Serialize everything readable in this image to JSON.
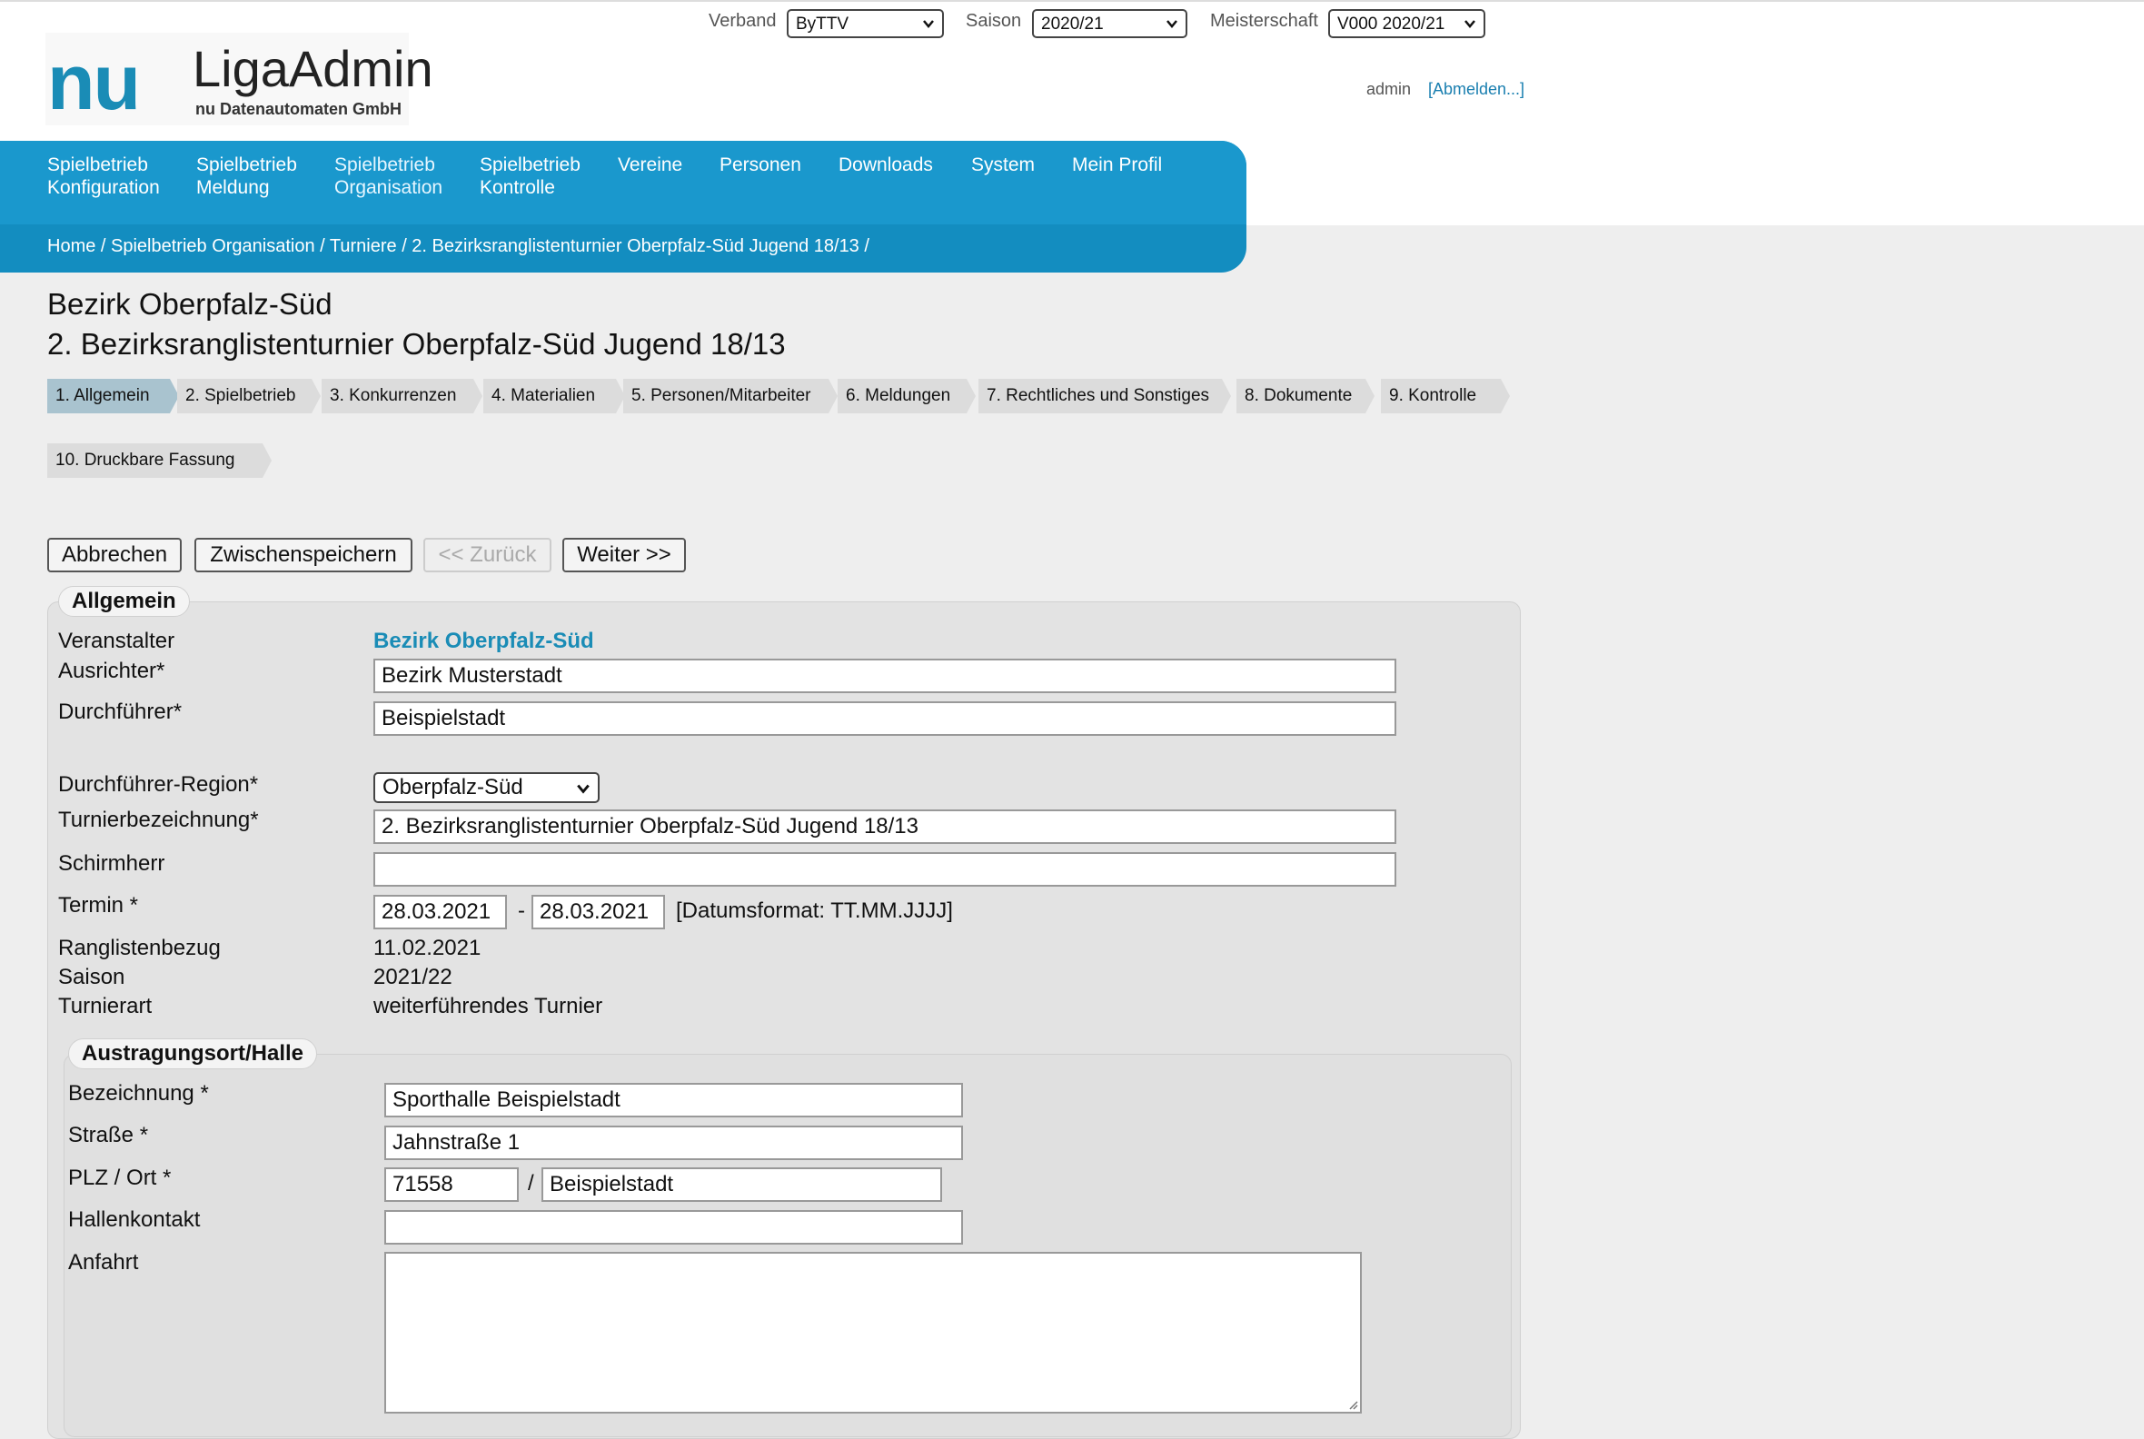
{
  "header": {
    "verband_label": "Verband",
    "verband_value": "ByTTV",
    "saison_label": "Saison",
    "saison_value": "2020/21",
    "meisterschaft_label": "Meisterschaft",
    "meisterschaft_value": "V000 2020/21",
    "user": "admin",
    "logout": "[Abmelden...]"
  },
  "logo": {
    "nu": "nu",
    "name": "LigaAdmin",
    "sub": "nu Datenautomaten GmbH"
  },
  "nav": {
    "items": [
      {
        "line1": "Spielbetrieb",
        "line2": "Konfiguration"
      },
      {
        "line1": "Spielbetrieb",
        "line2": "Meldung"
      },
      {
        "line1": "Spielbetrieb",
        "line2": "Organisation"
      },
      {
        "line1": "Spielbetrieb",
        "line2": "Kontrolle"
      },
      {
        "line1": "Vereine",
        "line2": ""
      },
      {
        "line1": "Personen",
        "line2": ""
      },
      {
        "line1": "Downloads",
        "line2": ""
      },
      {
        "line1": "System",
        "line2": ""
      },
      {
        "line1": "Mein Profil",
        "line2": ""
      }
    ],
    "breadcrumb": "Home / Spielbetrieb Organisation / Turniere / 2. Bezirksranglistenturnier Oberpfalz-Süd Jugend 18/13 /"
  },
  "page": {
    "title1": "Bezirk Oberpfalz-Süd",
    "title2": "2. Bezirksranglistenturnier Oberpfalz-Süd Jugend 18/13"
  },
  "tabs": [
    "1. Allgemein",
    "2. Spielbetrieb",
    "3. Konkurrenzen",
    "4. Materialien",
    "5. Personen/Mitarbeiter",
    "6. Meldungen",
    "7. Rechtliches und Sonstiges",
    "8. Dokumente",
    "9. Kontrolle",
    "10. Druckbare Fassung"
  ],
  "buttons": {
    "cancel": "Abbrechen",
    "save": "Zwischenspeichern",
    "back": "<< Zurück",
    "next": "Weiter >>"
  },
  "allgemein": {
    "legend": "Allgemein",
    "veranstalter_label": "Veranstalter",
    "veranstalter_value": "Bezirk Oberpfalz-Süd",
    "ausrichter_label": "Ausrichter*",
    "ausrichter_value": "Bezirk Musterstadt",
    "durchfuehrer_label": "Durchführer*",
    "durchfuehrer_value": "Beispielstadt",
    "region_label": "Durchführer-Region*",
    "region_value": "Oberpfalz-Süd",
    "turnierbezeichnung_label": "Turnierbezeichnung*",
    "turnierbezeichnung_value": "2. Bezirksranglistenturnier Oberpfalz-Süd Jugend 18/13",
    "schirmherr_label": "Schirmherr",
    "schirmherr_value": "",
    "termin_label": "Termin *",
    "termin_from": "28.03.2021",
    "termin_sep": "-",
    "termin_to": "28.03.2021",
    "termin_hint": "[Datumsformat: TT.MM.JJJJ]",
    "rangliste_label": "Ranglistenbezug",
    "rangliste_value": "11.02.2021",
    "saison_label": "Saison",
    "saison_value": "2021/22",
    "turnierart_label": "Turnierart",
    "turnierart_value": "weiterführendes Turnier"
  },
  "halle": {
    "legend": "Austragungsort/Halle",
    "bezeichnung_label": "Bezeichnung *",
    "bezeichnung_value": "Sporthalle Beispielstadt",
    "strasse_label": "Straße *",
    "strasse_value": "Jahnstraße 1",
    "plz_label": "PLZ / Ort *",
    "plz_value": "71558",
    "plz_sep": "/",
    "ort_value": "Beispielstadt",
    "kontakt_label": "Hallenkontakt",
    "kontakt_value": "",
    "anfahrt_label": "Anfahrt"
  }
}
